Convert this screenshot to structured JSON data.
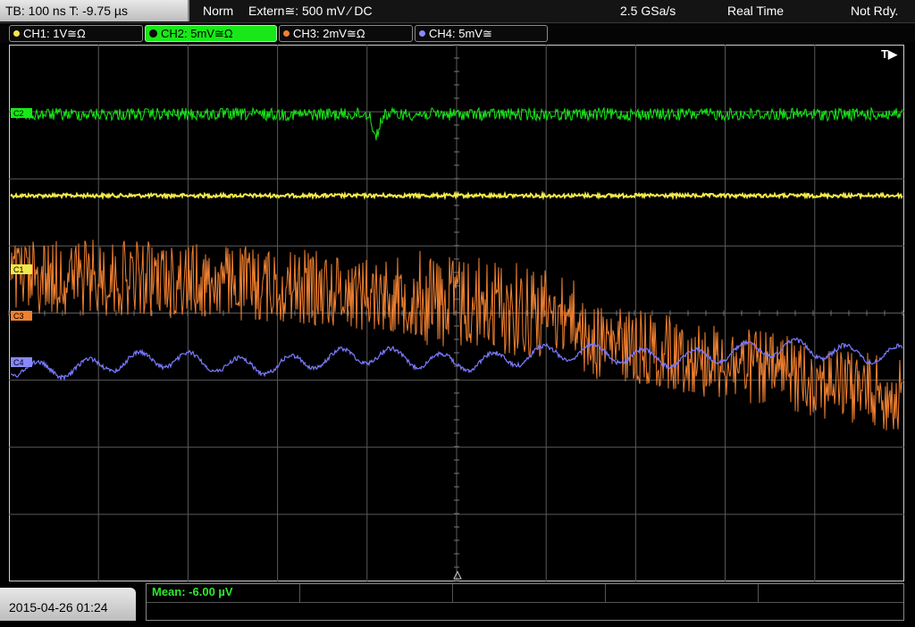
{
  "status": {
    "timebase": "TB: 100 ns   T: -9.75 µs",
    "mode": "Norm",
    "trigger": "Extern≅: 500 mV ⁄ DC",
    "sample_rate": "2.5 GSa/s",
    "acq_mode": "Real Time",
    "ready_state": "Not Rdy."
  },
  "channels": [
    {
      "label": "CH1: 1V≅Ω",
      "color": "#f2e84a",
      "icon": "circle-dot"
    },
    {
      "label": "CH2: 5mV≅Ω",
      "color": "#18e818",
      "icon": "circle-dot"
    },
    {
      "label": "CH3: 2mV≅Ω",
      "color": "#f08030",
      "icon": "circle-dot"
    },
    {
      "label": "CH4: 5mV≅",
      "color": "#8888ff",
      "icon": "circle-dot"
    }
  ],
  "trigger_marker": "T▶",
  "markers": {
    "c1": "C1",
    "c2": "C2",
    "c3": "C3",
    "c4": "C4"
  },
  "footer": {
    "datetime": "2015-04-26 01:24",
    "measurement": "Mean: -6.00 µV"
  }
}
